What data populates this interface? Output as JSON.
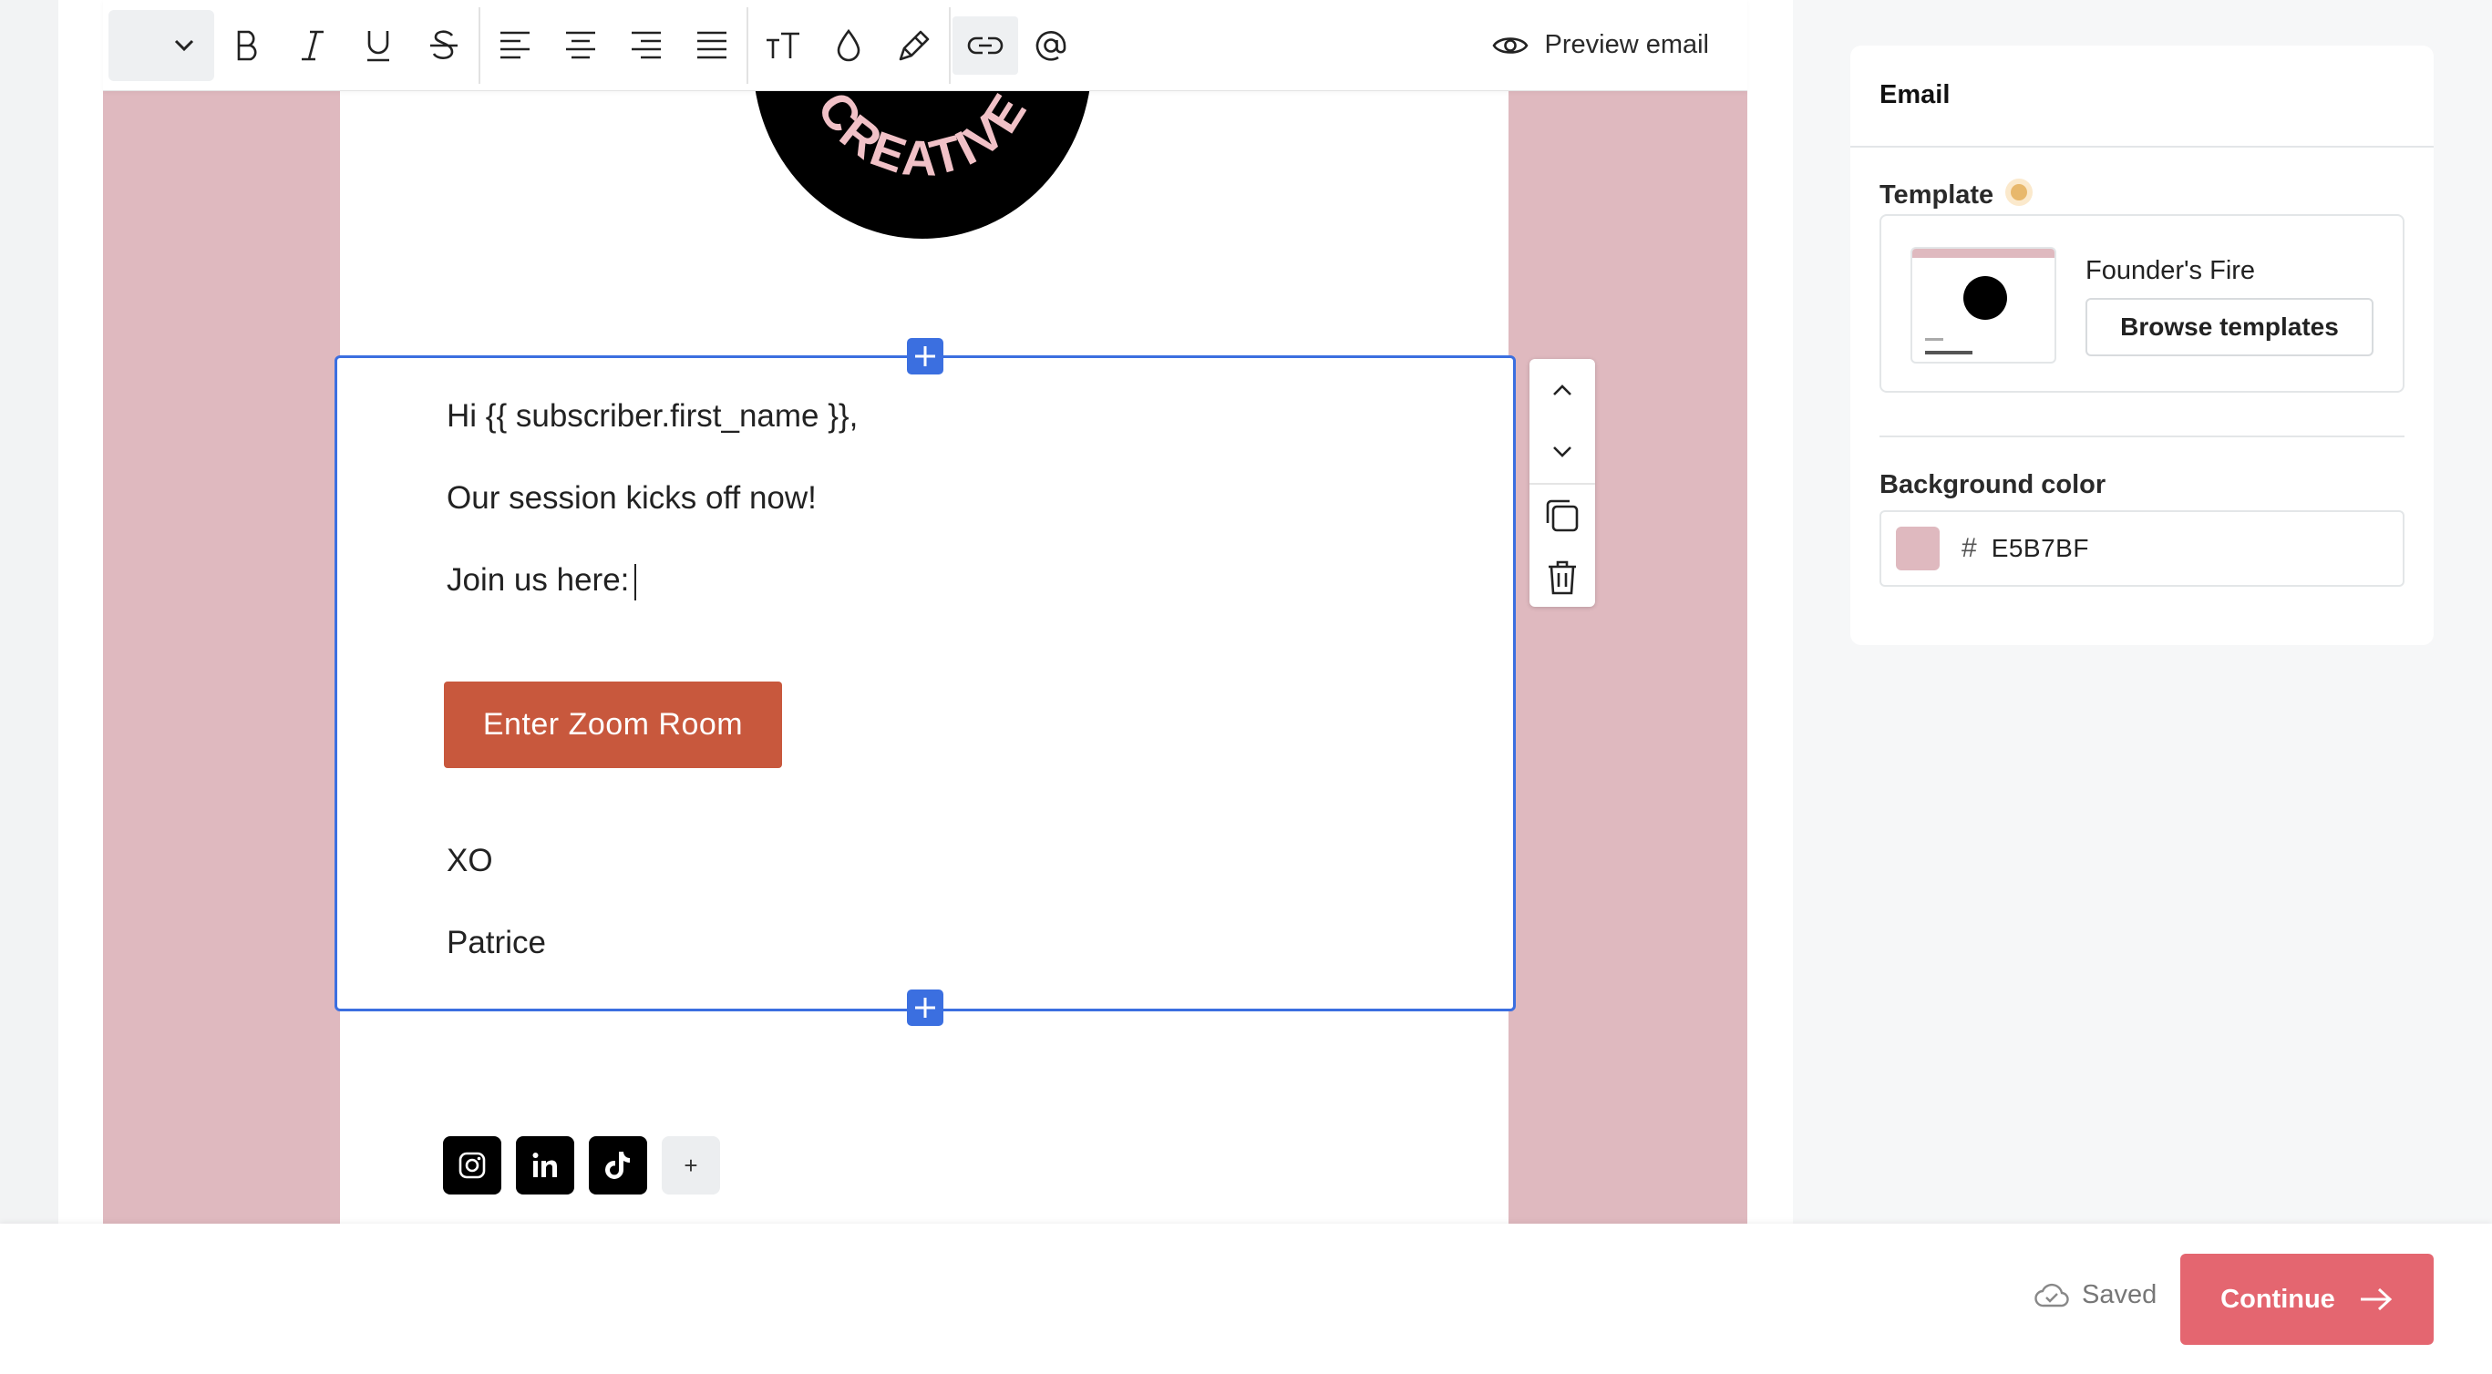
{
  "toolbar": {
    "preview_label": "Preview email"
  },
  "logo": {
    "text": "CREATIVE"
  },
  "block": {
    "greeting": "Hi {{ subscriber.first_name }},",
    "line1": "Our session kicks off now!",
    "line2": "Join us here:",
    "cta_label": "Enter Zoom Room",
    "signoff": "XO",
    "signature": "Patrice"
  },
  "social": {
    "items": [
      "instagram-icon",
      "linkedin-icon",
      "tiktok-icon"
    ],
    "add_label": "+"
  },
  "panel": {
    "title": "Email",
    "template_label": "Template",
    "template_name": "Founder's Fire",
    "browse_label": "Browse templates",
    "bg_label": "Background color",
    "bg_hash": "#",
    "bg_value": "E5B7BF"
  },
  "footer": {
    "saved_label": "Saved",
    "continue_label": "Continue"
  },
  "colors": {
    "canvas_bg": "#E5B7BF",
    "accent": "#3B6FE0",
    "cta": "#C8583D",
    "continue": "#E46670",
    "status_dot": "#E8B86C"
  }
}
